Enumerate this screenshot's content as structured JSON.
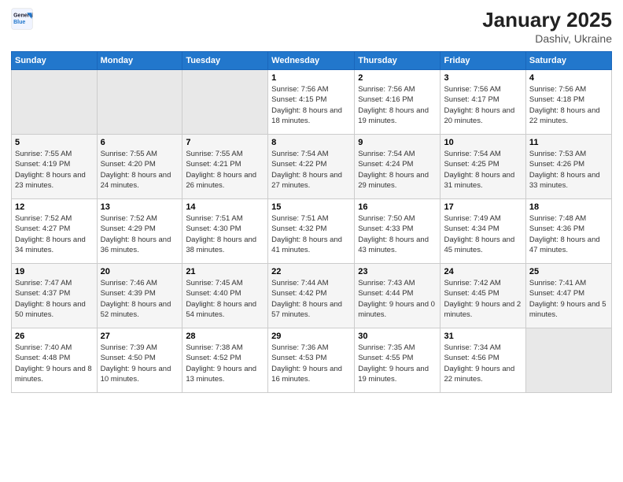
{
  "logo": {
    "line1": "General",
    "line2": "Blue"
  },
  "title": "January 2025",
  "subtitle": "Dashiv, Ukraine",
  "days_header": [
    "Sunday",
    "Monday",
    "Tuesday",
    "Wednesday",
    "Thursday",
    "Friday",
    "Saturday"
  ],
  "weeks": [
    [
      {
        "num": "",
        "info": ""
      },
      {
        "num": "",
        "info": ""
      },
      {
        "num": "",
        "info": ""
      },
      {
        "num": "1",
        "info": "Sunrise: 7:56 AM\nSunset: 4:15 PM\nDaylight: 8 hours and 18 minutes."
      },
      {
        "num": "2",
        "info": "Sunrise: 7:56 AM\nSunset: 4:16 PM\nDaylight: 8 hours and 19 minutes."
      },
      {
        "num": "3",
        "info": "Sunrise: 7:56 AM\nSunset: 4:17 PM\nDaylight: 8 hours and 20 minutes."
      },
      {
        "num": "4",
        "info": "Sunrise: 7:56 AM\nSunset: 4:18 PM\nDaylight: 8 hours and 22 minutes."
      }
    ],
    [
      {
        "num": "5",
        "info": "Sunrise: 7:55 AM\nSunset: 4:19 PM\nDaylight: 8 hours and 23 minutes."
      },
      {
        "num": "6",
        "info": "Sunrise: 7:55 AM\nSunset: 4:20 PM\nDaylight: 8 hours and 24 minutes."
      },
      {
        "num": "7",
        "info": "Sunrise: 7:55 AM\nSunset: 4:21 PM\nDaylight: 8 hours and 26 minutes."
      },
      {
        "num": "8",
        "info": "Sunrise: 7:54 AM\nSunset: 4:22 PM\nDaylight: 8 hours and 27 minutes."
      },
      {
        "num": "9",
        "info": "Sunrise: 7:54 AM\nSunset: 4:24 PM\nDaylight: 8 hours and 29 minutes."
      },
      {
        "num": "10",
        "info": "Sunrise: 7:54 AM\nSunset: 4:25 PM\nDaylight: 8 hours and 31 minutes."
      },
      {
        "num": "11",
        "info": "Sunrise: 7:53 AM\nSunset: 4:26 PM\nDaylight: 8 hours and 33 minutes."
      }
    ],
    [
      {
        "num": "12",
        "info": "Sunrise: 7:52 AM\nSunset: 4:27 PM\nDaylight: 8 hours and 34 minutes."
      },
      {
        "num": "13",
        "info": "Sunrise: 7:52 AM\nSunset: 4:29 PM\nDaylight: 8 hours and 36 minutes."
      },
      {
        "num": "14",
        "info": "Sunrise: 7:51 AM\nSunset: 4:30 PM\nDaylight: 8 hours and 38 minutes."
      },
      {
        "num": "15",
        "info": "Sunrise: 7:51 AM\nSunset: 4:32 PM\nDaylight: 8 hours and 41 minutes."
      },
      {
        "num": "16",
        "info": "Sunrise: 7:50 AM\nSunset: 4:33 PM\nDaylight: 8 hours and 43 minutes."
      },
      {
        "num": "17",
        "info": "Sunrise: 7:49 AM\nSunset: 4:34 PM\nDaylight: 8 hours and 45 minutes."
      },
      {
        "num": "18",
        "info": "Sunrise: 7:48 AM\nSunset: 4:36 PM\nDaylight: 8 hours and 47 minutes."
      }
    ],
    [
      {
        "num": "19",
        "info": "Sunrise: 7:47 AM\nSunset: 4:37 PM\nDaylight: 8 hours and 50 minutes."
      },
      {
        "num": "20",
        "info": "Sunrise: 7:46 AM\nSunset: 4:39 PM\nDaylight: 8 hours and 52 minutes."
      },
      {
        "num": "21",
        "info": "Sunrise: 7:45 AM\nSunset: 4:40 PM\nDaylight: 8 hours and 54 minutes."
      },
      {
        "num": "22",
        "info": "Sunrise: 7:44 AM\nSunset: 4:42 PM\nDaylight: 8 hours and 57 minutes."
      },
      {
        "num": "23",
        "info": "Sunrise: 7:43 AM\nSunset: 4:44 PM\nDaylight: 9 hours and 0 minutes."
      },
      {
        "num": "24",
        "info": "Sunrise: 7:42 AM\nSunset: 4:45 PM\nDaylight: 9 hours and 2 minutes."
      },
      {
        "num": "25",
        "info": "Sunrise: 7:41 AM\nSunset: 4:47 PM\nDaylight: 9 hours and 5 minutes."
      }
    ],
    [
      {
        "num": "26",
        "info": "Sunrise: 7:40 AM\nSunset: 4:48 PM\nDaylight: 9 hours and 8 minutes."
      },
      {
        "num": "27",
        "info": "Sunrise: 7:39 AM\nSunset: 4:50 PM\nDaylight: 9 hours and 10 minutes."
      },
      {
        "num": "28",
        "info": "Sunrise: 7:38 AM\nSunset: 4:52 PM\nDaylight: 9 hours and 13 minutes."
      },
      {
        "num": "29",
        "info": "Sunrise: 7:36 AM\nSunset: 4:53 PM\nDaylight: 9 hours and 16 minutes."
      },
      {
        "num": "30",
        "info": "Sunrise: 7:35 AM\nSunset: 4:55 PM\nDaylight: 9 hours and 19 minutes."
      },
      {
        "num": "31",
        "info": "Sunrise: 7:34 AM\nSunset: 4:56 PM\nDaylight: 9 hours and 22 minutes."
      },
      {
        "num": "",
        "info": ""
      }
    ]
  ]
}
